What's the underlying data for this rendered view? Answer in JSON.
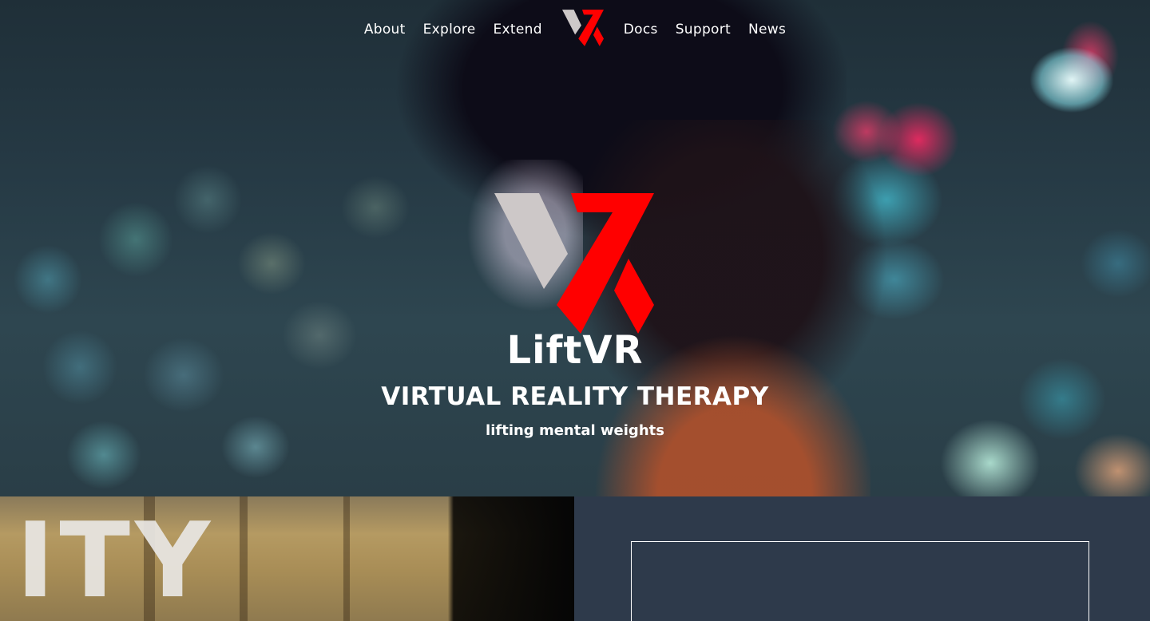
{
  "nav": {
    "left_links": [
      {
        "label": "About"
      },
      {
        "label": "Explore"
      },
      {
        "label": "Extend"
      }
    ],
    "right_links": [
      {
        "label": "Docs"
      },
      {
        "label": "Support"
      },
      {
        "label": "News"
      }
    ],
    "logo_icon": "liftvr-logo-icon"
  },
  "hero": {
    "brand": "LiftVR",
    "tagline": "VIRTUAL REALITY THERAPY",
    "subtagline": "lifting mental weights",
    "logo_icon": "liftvr-logo-icon"
  },
  "lower": {
    "image_sign_text": "ITY"
  },
  "colors": {
    "brand_red": "#ff0000",
    "logo_light": "#cdc8c8",
    "panel_bg": "#2e3a4b",
    "text": "#ffffff"
  }
}
